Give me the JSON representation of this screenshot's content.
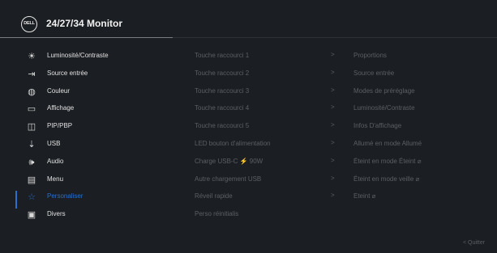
{
  "header": {
    "logo_text": "DELL",
    "title": "24/27/34 Monitor"
  },
  "menu": [
    {
      "label": "Luminosité/Contraste",
      "icon": "brightness-icon",
      "glyph": "☀"
    },
    {
      "label": "Source entrée",
      "icon": "input-source-icon",
      "glyph": "⇥"
    },
    {
      "label": "Couleur",
      "icon": "color-icon",
      "glyph": "◍"
    },
    {
      "label": "Affichage",
      "icon": "display-icon",
      "glyph": "▭"
    },
    {
      "label": "PIP/PBP",
      "icon": "pip-pbp-icon",
      "glyph": "◫"
    },
    {
      "label": "USB",
      "icon": "usb-icon",
      "glyph": "⇣"
    },
    {
      "label": "Audio",
      "icon": "audio-icon",
      "glyph": "🕪"
    },
    {
      "label": "Menu",
      "icon": "menu-icon",
      "glyph": "▤"
    },
    {
      "label": "Personaliser",
      "icon": "star-icon",
      "glyph": "☆"
    },
    {
      "label": "Divers",
      "icon": "misc-icon",
      "glyph": "▣"
    }
  ],
  "active_index": 8,
  "options": [
    {
      "label": "Touche raccourci 1",
      "arrow": ">"
    },
    {
      "label": "Touche raccourci 2",
      "arrow": ">"
    },
    {
      "label": "Touche raccourci 3",
      "arrow": ">"
    },
    {
      "label": "Touche raccourci 4",
      "arrow": ">"
    },
    {
      "label": "Touche raccourci 5",
      "arrow": ">"
    },
    {
      "label": "LED bouton d'alimentation",
      "arrow": ">"
    },
    {
      "label": "Charge USB-C ⚡ 90W",
      "arrow": ">"
    },
    {
      "label": "Autre chargement USB",
      "arrow": ">"
    },
    {
      "label": "Réveil rapide",
      "arrow": ">"
    },
    {
      "label": "Perso réinitialis",
      "arrow": ""
    }
  ],
  "values": [
    "Proportions",
    "Source entrée",
    "Modes de préréglage",
    "Luminosité/Contraste",
    "Infos D'affichage",
    "Allumé en mode Allumé",
    "Éteint en mode Éteint ⌀",
    "Éteint en mode veille ⌀",
    "Eteint ⌀",
    ""
  ],
  "footer": {
    "quit_label": "< Quitter"
  },
  "colors": {
    "background": "#1b1e22",
    "accent": "#2a6fc9",
    "text": "#e0e0e0",
    "muted": "#5c5f64"
  }
}
